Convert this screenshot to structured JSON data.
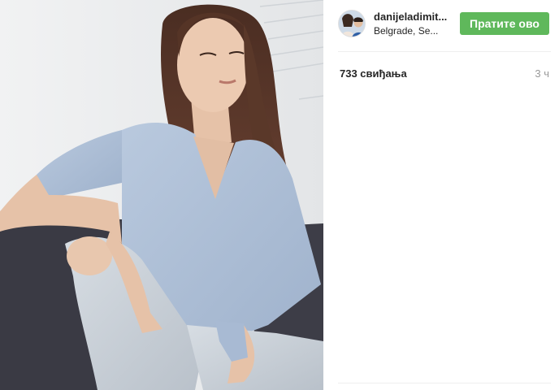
{
  "post": {
    "image_alt": "photo",
    "likes_text": "733 свиђања",
    "time_text": "3 ч"
  },
  "header": {
    "username": "danijeladimit...",
    "location": "Belgrade, Se...",
    "follow_label": "Пратите ово"
  },
  "colors": {
    "follow_button": "#5fb85b",
    "divider": "#efefef",
    "muted_text": "#999999"
  },
  "icons": {
    "avatar": "profile-photo"
  }
}
